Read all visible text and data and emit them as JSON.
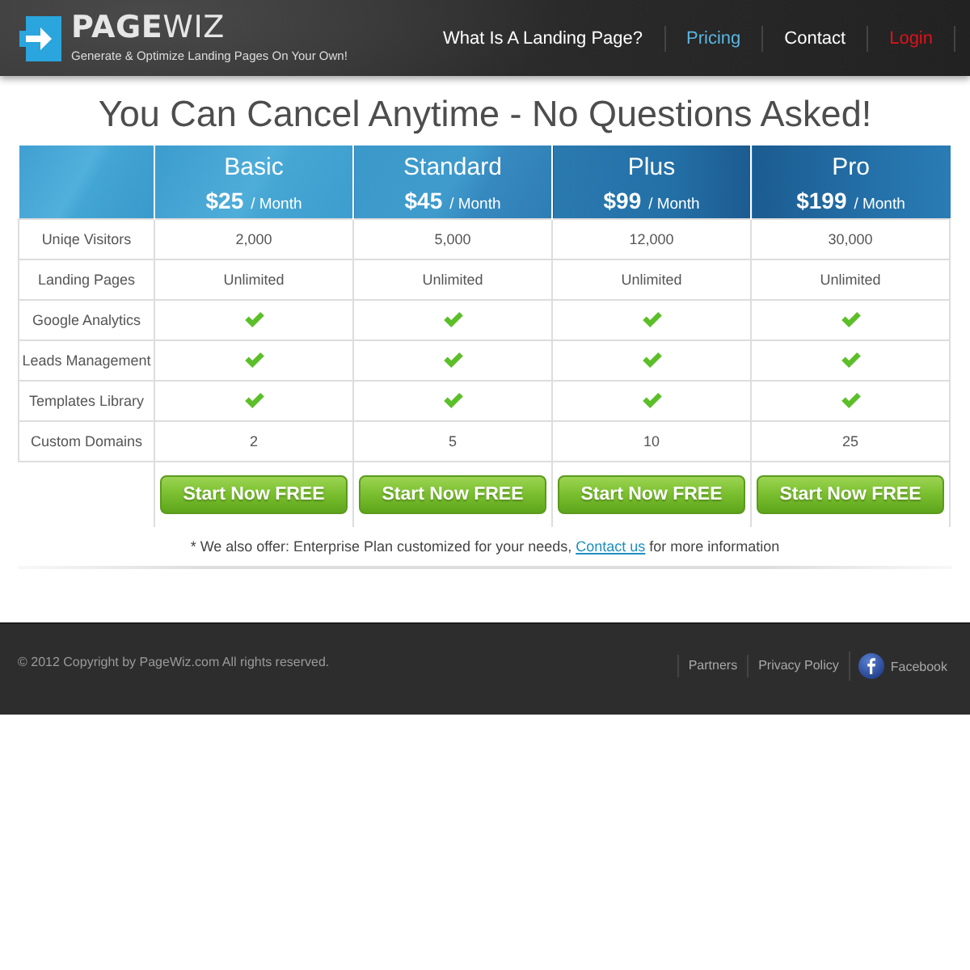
{
  "header": {
    "logo": {
      "wordmark": "**PAGE**WIZ",
      "tagline": "Generate & Optimize Landing Pages On Your Own!"
    },
    "nav": [
      {
        "label": "What Is A Landing Page?",
        "kind": "link",
        "selected": false
      },
      {
        "label": "Pricing",
        "kind": "link",
        "selected": true
      },
      {
        "label": "Contact",
        "kind": "link",
        "selected": false
      },
      {
        "label": "Login",
        "kind": "login",
        "selected": false
      }
    ]
  },
  "title": "You Can Cancel Anytime - No Questions Asked!",
  "pricing": {
    "plans": [
      {
        "name": "Basic",
        "price": "$25",
        "period": "/ Month",
        "button": "Start Now FREE"
      },
      {
        "name": "Standard",
        "price": "$45",
        "period": "/ Month",
        "button": "Start Now FREE"
      },
      {
        "name": "Plus",
        "price": "$99",
        "period": "/ Month",
        "button": "Start Now FREE"
      },
      {
        "name": "Pro",
        "price": "$199",
        "period": "/ Month",
        "button": "Start Now FREE"
      }
    ],
    "features": [
      {
        "label": "Uniqe Visitors",
        "kind": "text",
        "values": [
          "2,000",
          "5,000",
          "12,000",
          "30,000"
        ]
      },
      {
        "label": "Landing Pages",
        "kind": "text",
        "values": [
          "Unlimited",
          "Unlimited",
          "Unlimited",
          "Unlimited"
        ]
      },
      {
        "label": "Google Analytics",
        "kind": "check",
        "values": [
          true,
          true,
          true,
          true
        ]
      },
      {
        "label": "Leads Management",
        "kind": "check",
        "values": [
          true,
          true,
          true,
          true
        ]
      },
      {
        "label": "Templates Library",
        "kind": "check",
        "values": [
          true,
          true,
          true,
          true
        ]
      },
      {
        "label": "Custom Domains",
        "kind": "text",
        "values": [
          "2",
          "5",
          "10",
          "25"
        ]
      }
    ]
  },
  "note": {
    "before": "* We also offer: Enterprise Plan customized for your needs,",
    "link": "Contact us",
    "after": "for more information"
  },
  "footer": {
    "copyright": "© 2012 Copyright by PageWiz.com All rights reserved.",
    "links": [
      "Partners",
      "Privacy Policy"
    ],
    "social": "Facebook"
  }
}
